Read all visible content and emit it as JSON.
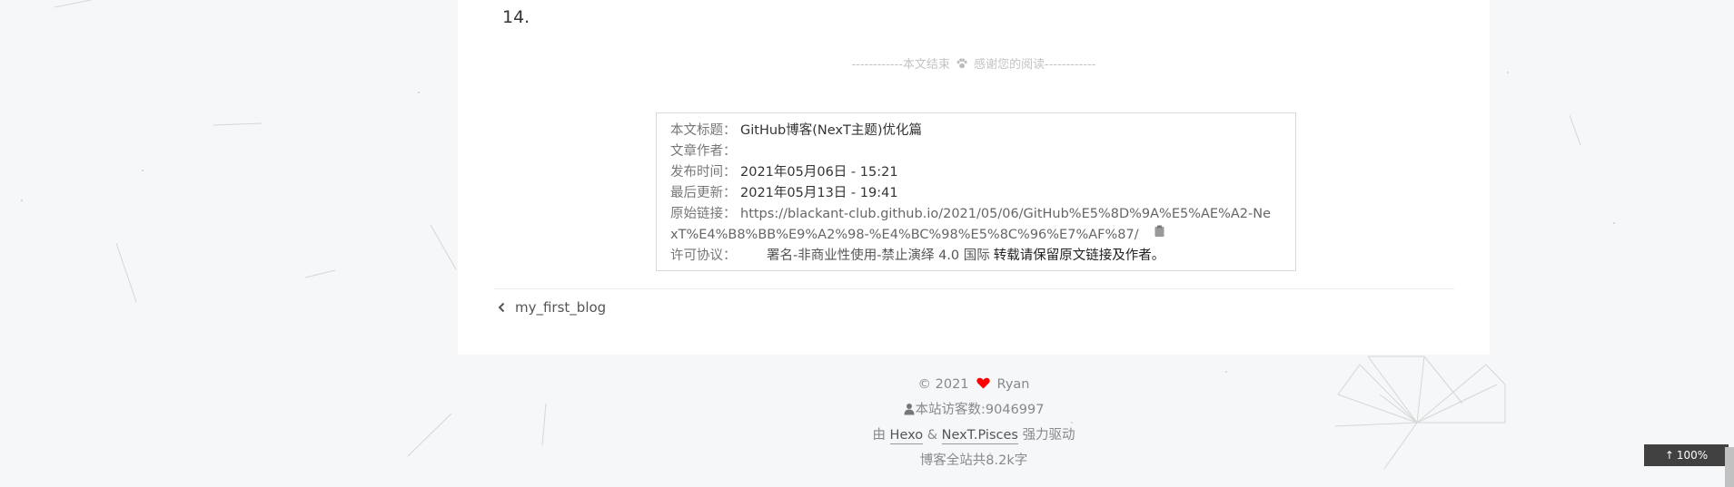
{
  "content": {
    "list_number": "14."
  },
  "post_end": {
    "left": "------------本文结束",
    "right": "感谢您的阅读------------",
    "icon": "paw-icon"
  },
  "copyright": {
    "rows": [
      {
        "key": "本文标题：",
        "value": "GitHub博客(NexT主题)优化篇"
      },
      {
        "key": "文章作者：",
        "value": ""
      },
      {
        "key": "发布时间：",
        "value": "2021年05月06日 - 15:21"
      },
      {
        "key": "最后更新：",
        "value": "2021年05月13日 - 19:41"
      }
    ],
    "link_key": "原始链接：",
    "link_line1": "https://blackant-club.github.io/2021/05/06/GitHub%E5%8D%9A%E5%AE%A2-Ne",
    "link_line2": "xT%E4%B8%BB%E9%A2%98-%E4%BC%98%E5%8C%96%E7%AF%87/",
    "copy_icon": "clipboard-icon",
    "license_key": "许可协议：",
    "license_text": "署名-非商业性使用-禁止演绎 4.0 国际",
    "license_note": "转载请保留原文链接及作者。"
  },
  "navigation": {
    "prev_label": "my_first_blog",
    "prev_icon": "chevron-left-icon"
  },
  "footer": {
    "year": "© 2021",
    "author": "Ryan",
    "heart_color": "#ff0000",
    "visitors": "本站访客数:9046997",
    "powered_prefix": "由",
    "hexo": "Hexo",
    "amp": "&",
    "theme": "NexT.Pisces",
    "powered_suffix": "强力驱动",
    "wordcount": "博客全站共8.2k字"
  },
  "back_to_top": {
    "label": "100%",
    "icon": "arrow-up-icon"
  }
}
